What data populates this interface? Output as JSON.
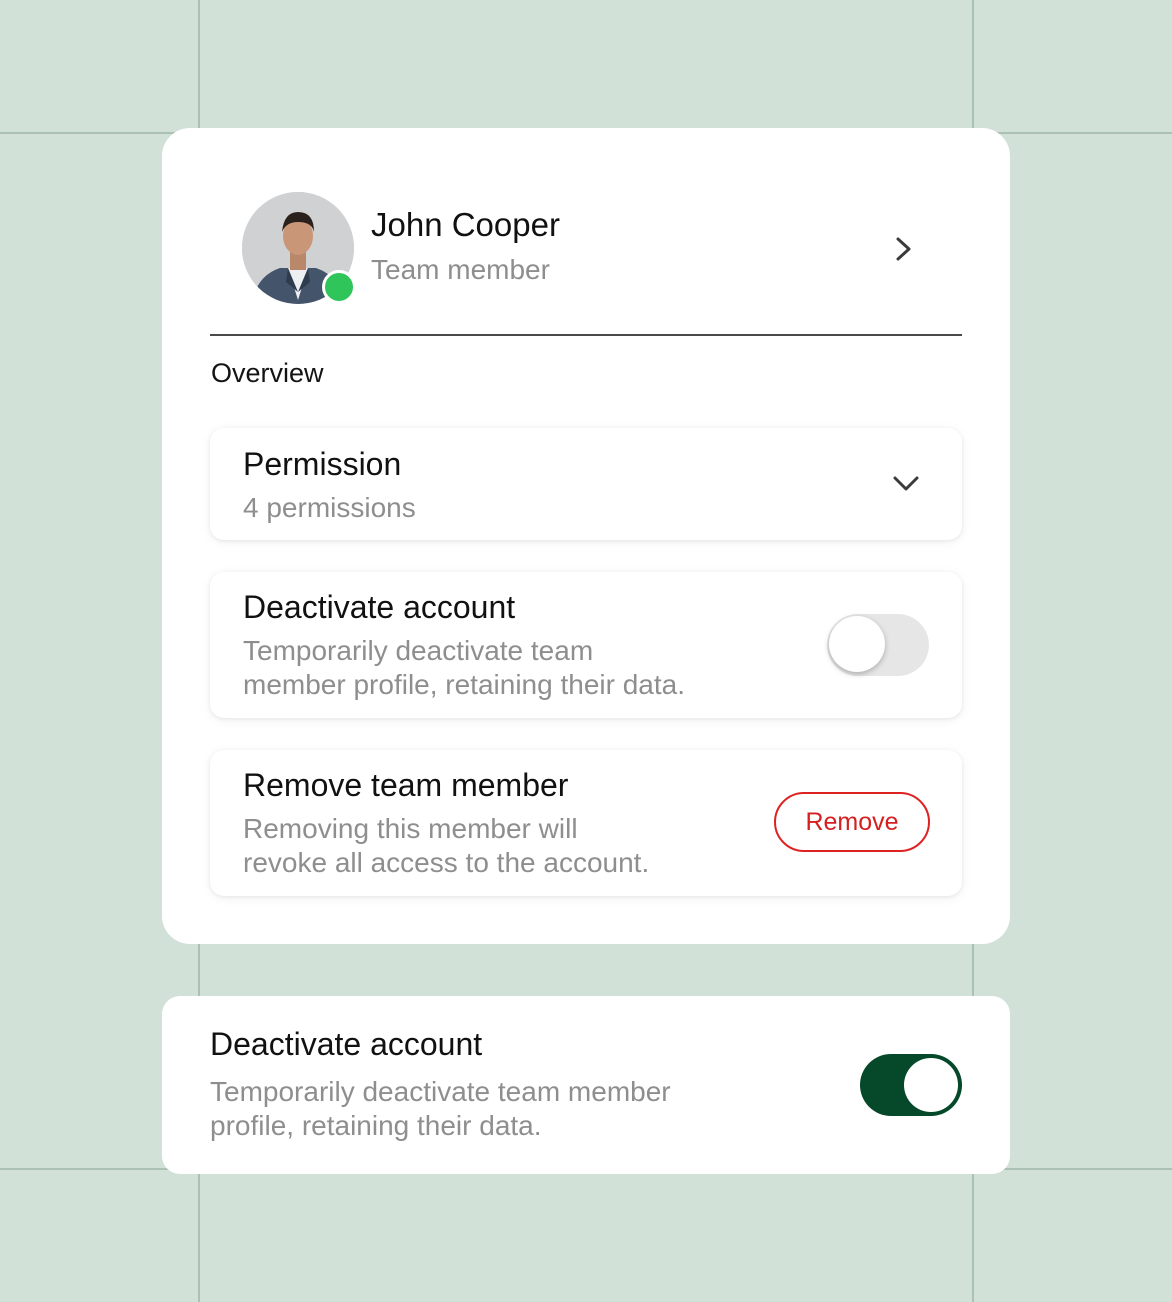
{
  "profile": {
    "name": "John Cooper",
    "role": "Team member",
    "status": "online",
    "status_color": "#2fc55a"
  },
  "section_label": "Overview",
  "permission": {
    "title": "Permission",
    "subtitle": "4 permissions",
    "expanded": false
  },
  "deactivate": {
    "title": "Deactivate account",
    "subtitle_line1": "Temporarily deactivate team",
    "subtitle_line2": "member profile, retaining their data.",
    "enabled": false
  },
  "remove_member": {
    "title": "Remove team member",
    "subtitle_line1": "Removing this member will",
    "subtitle_line2": "revoke all access to the account.",
    "button_label": "Remove",
    "button_color": "#de2222"
  },
  "deactivate_alt": {
    "title": "Deactivate account",
    "subtitle_line1": "Temporarily deactivate team member",
    "subtitle_line2": "profile, retaining their data.",
    "enabled": true,
    "toggle_color": "#05482a"
  },
  "theme": {
    "background": "#d1e1d7",
    "card": "#ffffff"
  }
}
